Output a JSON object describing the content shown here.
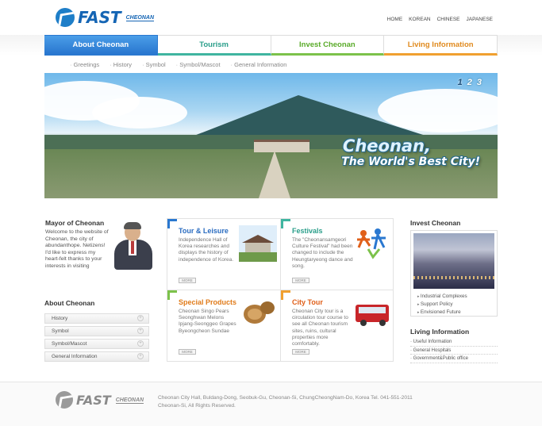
{
  "header": {
    "logo_text": "FAST",
    "logo_sub": "CHEONAN",
    "languages": [
      "HOME",
      "KOREAN",
      "CHINESE",
      "JAPANESE"
    ]
  },
  "gnb": {
    "tabs": [
      "About Cheonan",
      "Tourism",
      "Invest Cheonan",
      "Living Information"
    ],
    "active": "About Cheonan"
  },
  "subnav": [
    "Greetings",
    "History",
    "Symbol",
    "Symbol/Mascot",
    "General Information"
  ],
  "hero": {
    "title_line1": "Cheonan,",
    "title_line2": "The World's Best City!",
    "pages": [
      "1",
      "2",
      "3"
    ],
    "active_page": "1"
  },
  "mayor": {
    "title": "Mayor of Cheonan",
    "text": "Welcome to the website of Cheonan, the city of abundanthope. Netizens! I'd like to express my heart-felt thanks to your interests in visiting"
  },
  "about": {
    "title": "About Cheonan",
    "items": [
      "History",
      "Symbol",
      "Symbol/Mascot",
      "General Information"
    ]
  },
  "cards": [
    {
      "title": "Tour & Leisure",
      "desc": "Independence Hall of Korea researches and displays the history of independence of Korea.",
      "more": "MORE"
    },
    {
      "title": "Festivals",
      "desc": "The \"Cheonansamgeori Culture Festival\" had been changed to include the Heungtaryeong dance and song.",
      "more": "MORE"
    },
    {
      "title": "Special Products",
      "desc": "Cheonan Singo Pears Seonghwan Melons Ipjang-Seonggeo Grapes Byeongcheon Sundae",
      "more": "MORE"
    },
    {
      "title": "City Tour",
      "desc": "Cheonan City tour is a circulation tour course to see all Cheonan tourism sites, ruins, cultural properties more comfortably.",
      "more": "MORE"
    }
  ],
  "invest": {
    "title": "Invest Cheonan",
    "links": [
      "Industrial Complexes",
      "Support Policy",
      "Envisioned Future"
    ]
  },
  "living": {
    "title": "Living Information",
    "links": [
      "Useful Information",
      "General Hospitals",
      "Government&Public office"
    ]
  },
  "footer": {
    "line1": "Cheonan City Hall, Buldang-Dong, Seobuk-Gu, Cheonan-Si, ChungCheongNam-Do, Korea Tel. 041-551-2011",
    "line2": "Cheonan-Si, All Rights Reserved."
  },
  "colors": {
    "primary_blue": "#2a78d0",
    "tourism_teal": "#3fb5a0",
    "invest_green": "#7cc24b",
    "living_orange": "#f0a030"
  }
}
